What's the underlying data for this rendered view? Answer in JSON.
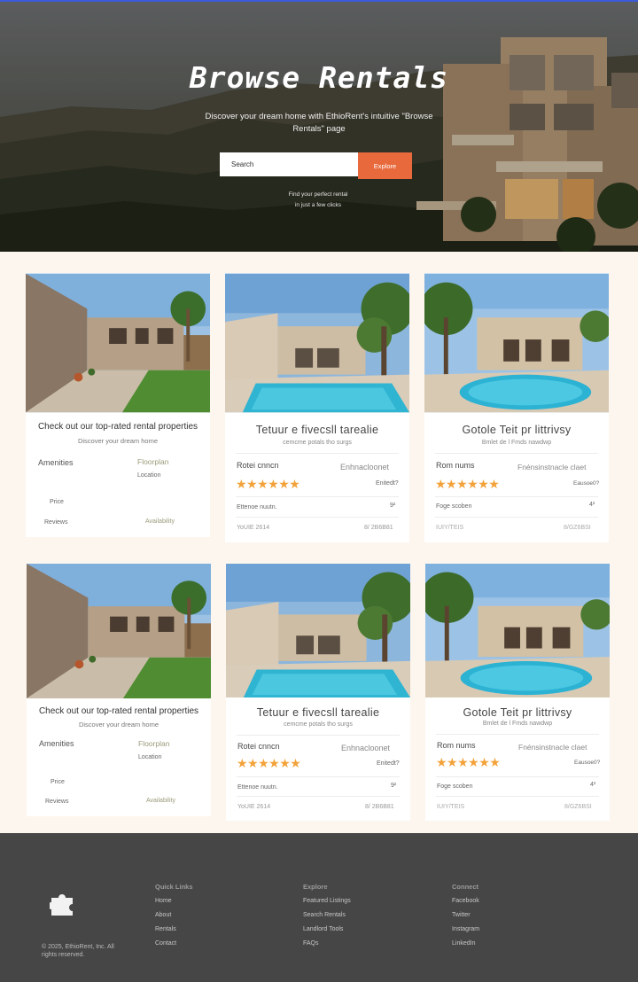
{
  "hero": {
    "title": "Browse Rentals",
    "subtitle": "Discover your dream home with EthioRent's intuitive \"Browse Rentals\" page",
    "search_placeholder": "Search",
    "explore_label": "Explore",
    "tagline_1": "Find your perfect rental",
    "tagline_2": "in just a few clicks"
  },
  "card_a": {
    "title": "Check out our top-rated rental properties",
    "subtitle": "Discover your dream home",
    "amenities": "Amenities",
    "floorplan": "Floorplan",
    "location": "Location",
    "price": "Price",
    "reviews": "Reviews",
    "availability": "Availability"
  },
  "card_b": {
    "title": "Tetuur e fivecsll tarealie",
    "title_row2": "Tetuur e fivecsll tarealie",
    "subtitle": "cemcme potals tho surgs",
    "subtitle_row2": "cemcme potals tho surgs",
    "label_left": "Rotei cnncn",
    "label_right": "Enhnacloonet",
    "rating_stars": 5,
    "rating_text": "Enitedt?",
    "row3_left": "Ettenoe nuutn.",
    "row3_right": "9²",
    "row4_left": "YoUIE 2614",
    "row4_right": "8/ 2B6B81"
  },
  "card_c": {
    "title": "Gotole Teit pr littrivsy",
    "subtitle": "Bmlet de l Fmds nawdwp",
    "label_left": "Rom nums",
    "label_right": "Fnénsinstnacle claet",
    "rating_stars": 5,
    "rating_text": "Eausoe0?",
    "row3_left": "Foge scoben",
    "row3_right": "4²",
    "row4_left": "IUIY/TEIS",
    "row4_right": "8/GZ6BSI"
  },
  "footer": {
    "copyright": "© 2025, EthioRent, Inc. All rights reserved.",
    "quick_links": {
      "heading": "Quick Links",
      "items": [
        "Home",
        "About",
        "Rentals",
        "Contact"
      ]
    },
    "explore": {
      "heading": "Explore",
      "items": [
        "Featured Listings",
        "Search Rentals",
        "Landlord Tools",
        "FAQs"
      ]
    },
    "connect": {
      "heading": "Connect",
      "items": [
        "Facebook",
        "Twitter",
        "Instagram",
        "LinkedIn"
      ]
    }
  },
  "colors": {
    "accent": "#e8693c",
    "page_bg": "#fdf6ee",
    "footer_bg": "#464646",
    "star": "#f3a23a"
  }
}
